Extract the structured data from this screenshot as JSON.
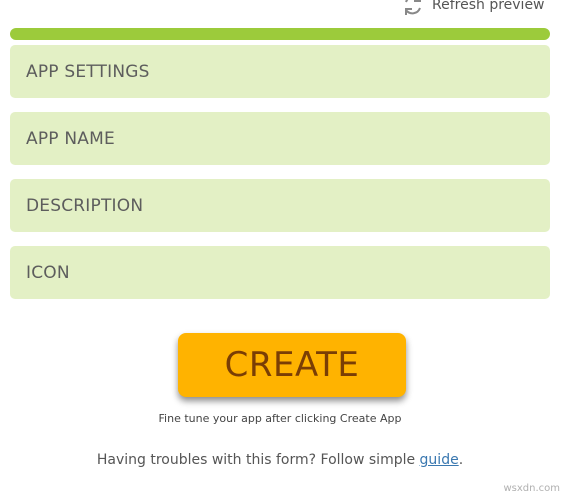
{
  "header": {
    "refresh_label": "Refresh preview",
    "refresh_icon": "refresh-icon"
  },
  "progress": {
    "color": "#9ccb3b"
  },
  "sections": [
    {
      "label": "APP SETTINGS"
    },
    {
      "label": "APP NAME"
    },
    {
      "label": "DESCRIPTION"
    },
    {
      "label": "ICON"
    }
  ],
  "colors": {
    "section_bg": "#e3f0c5",
    "create_bg": "#ffb300",
    "create_text": "#7a3e05",
    "link": "#3a78b0"
  },
  "create": {
    "label": "CREATE",
    "hint": "Fine tune your app after clicking Create App"
  },
  "help": {
    "text_before": "Having troubles with this form? Follow simple ",
    "link_text": "guide",
    "text_after": "."
  },
  "watermark": "wsxdn.com"
}
